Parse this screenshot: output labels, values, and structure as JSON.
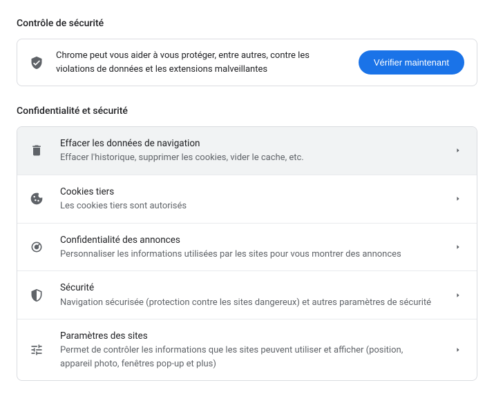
{
  "safety": {
    "heading": "Contrôle de sécurité",
    "text": "Chrome peut vous aider à vous protéger, entre autres, contre les violations de données et les extensions malveillantes",
    "button": "Vérifier maintenant"
  },
  "privacy": {
    "heading": "Confidentialité et sécurité",
    "items": [
      {
        "title": "Effacer les données de navigation",
        "sub": "Effacer l'historique, supprimer les cookies, vider le cache, etc."
      },
      {
        "title": "Cookies tiers",
        "sub": "Les cookies tiers sont autorisés"
      },
      {
        "title": "Confidentialité des annonces",
        "sub": "Personnaliser les informations utilisées par les sites pour vous montrer des annonces"
      },
      {
        "title": "Sécurité",
        "sub": "Navigation sécurisée (protection contre les sites dangereux) et autres paramètres de sécurité"
      },
      {
        "title": "Paramètres des sites",
        "sub": "Permet de contrôler les informations que les sites peuvent utiliser et afficher (position, appareil photo, fenêtres pop-up et plus)"
      }
    ]
  }
}
